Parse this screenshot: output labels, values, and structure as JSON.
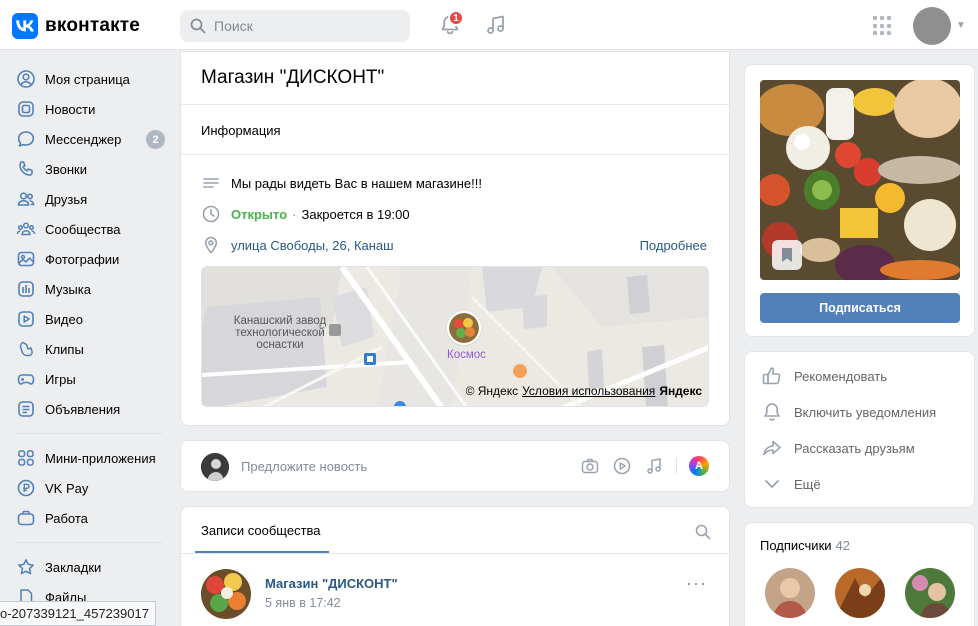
{
  "header": {
    "logo_letter": "VK",
    "logo_text": "вконтакте",
    "search_placeholder": "Поиск",
    "notifications_count": "1"
  },
  "sidebar": {
    "items": [
      {
        "label": "Моя страница",
        "icon": "user-icon"
      },
      {
        "label": "Новости",
        "icon": "news-icon"
      },
      {
        "label": "Мессенджер",
        "icon": "message-icon",
        "badge": "2"
      },
      {
        "label": "Звонки",
        "icon": "phone-icon"
      },
      {
        "label": "Друзья",
        "icon": "friends-icon"
      },
      {
        "label": "Сообщества",
        "icon": "communities-icon"
      },
      {
        "label": "Фотографии",
        "icon": "photo-icon"
      },
      {
        "label": "Музыка",
        "icon": "music-icon"
      },
      {
        "label": "Видео",
        "icon": "video-icon"
      },
      {
        "label": "Клипы",
        "icon": "clips-icon"
      },
      {
        "label": "Игры",
        "icon": "games-icon"
      },
      {
        "label": "Объявления",
        "icon": "ads-icon"
      }
    ],
    "items2": [
      {
        "label": "Мини-приложения",
        "icon": "apps-icon"
      },
      {
        "label": "VK Pay",
        "icon": "vkpay-icon"
      },
      {
        "label": "Работа",
        "icon": "work-icon"
      }
    ],
    "items3": [
      {
        "label": "Закладки",
        "icon": "star-icon"
      },
      {
        "label": "Файлы",
        "icon": "file-icon"
      }
    ]
  },
  "page": {
    "title": "Магазин \"ДИСКОНТ\"",
    "info_tab": "Информация",
    "description": "Мы рады видеть Вас в нашем магазине!!!",
    "status_open": "Открыто",
    "status_closes": "Закроется в 19:00",
    "address": "улица Свободы, 26, Канаш",
    "more_link": "Подробнее"
  },
  "map": {
    "poi_factory": "Канашский завод технологической оснастки",
    "poi_store": "Космос",
    "attrib_copy": "© Яндекс",
    "attrib_terms": "Условия использования",
    "attrib_brand": "Яндекс"
  },
  "suggest": {
    "placeholder": "Предложите новость"
  },
  "posts": {
    "tab": "Записи сообщества",
    "post": {
      "author": "Магазин \"ДИСКОНТ\"",
      "date": "5 янв в 17:42"
    }
  },
  "right": {
    "subscribe_label": "Подписаться",
    "actions": [
      "Рекомендовать",
      "Включить уведомления",
      "Рассказать друзьям",
      "Ещё"
    ],
    "subscribers_title": "Подписчики",
    "subscribers_count": "42"
  },
  "status_bar": {
    "url": "o-207339121_457239017"
  },
  "colors": {
    "accent": "#5181b8",
    "link": "#2a5885",
    "open_green": "#4bb34b",
    "badge_red": "#e64646"
  }
}
